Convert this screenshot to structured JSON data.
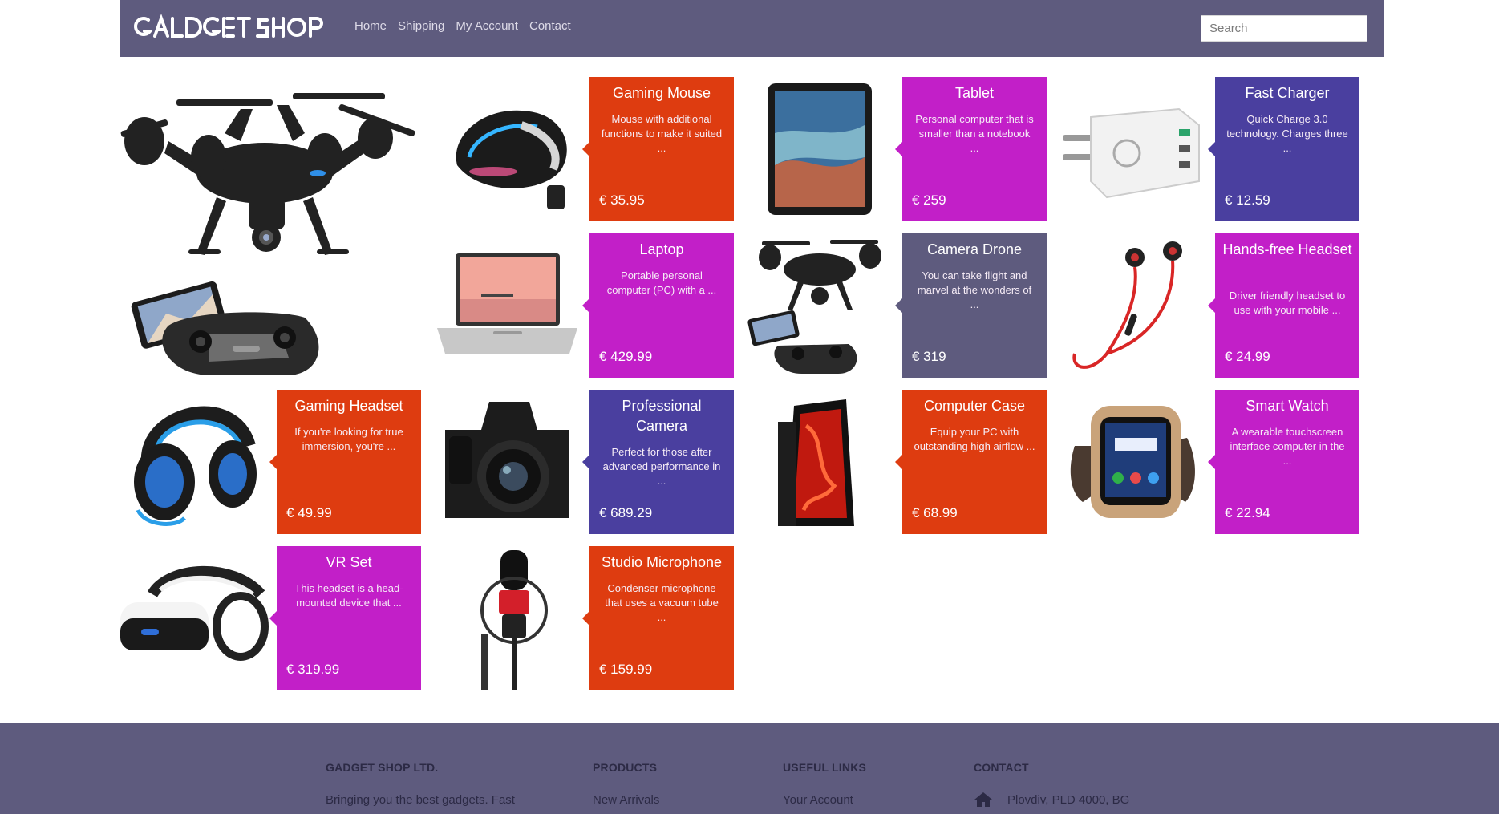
{
  "header": {
    "logo_text": "GADGET SHOP",
    "nav": [
      "Home",
      "Shipping",
      "My Account",
      "Contact"
    ],
    "search_placeholder": "Search"
  },
  "colors": {
    "nav_bg": "#5e5b7e",
    "orange": "#de3c10",
    "magenta": "#c21fc8",
    "indigo": "#4a3f9f",
    "slate": "#5e5b7e"
  },
  "products": [
    {
      "title": "Gaming Mouse",
      "desc": "Mouse with additional functions to make it suited ...",
      "price": "€ 35.95",
      "color": "orange",
      "image": "gaming-mouse-image"
    },
    {
      "title": "Tablet",
      "desc": "Personal computer that is smaller than a notebook ...",
      "price": "€ 259",
      "color": "magenta",
      "image": "tablet-image"
    },
    {
      "title": "Fast Charger",
      "desc": "Quick Charge 3.0 technology. Charges three ...",
      "price": "€ 12.59",
      "color": "indigo",
      "image": "charger-image"
    },
    {
      "title": "Laptop",
      "desc": "Portable personal computer (PC) with a ...",
      "price": "€ 429.99",
      "color": "magenta",
      "image": "laptop-image"
    },
    {
      "title": "Camera Drone",
      "desc": "You can take flight and marvel at the wonders of ...",
      "price": "€ 319",
      "color": "slate",
      "image": "camera-drone-image"
    },
    {
      "title": "Hands-free Headset",
      "desc": "Driver friendly headset to use with your mobile ...",
      "price": "€ 24.99",
      "color": "magenta",
      "image": "earphones-image"
    },
    {
      "title": "Gaming Headset",
      "desc": "If you're looking for true immersion, you're ...",
      "price": "€ 49.99",
      "color": "orange",
      "image": "gaming-headset-image"
    },
    {
      "title": "Professional Camera",
      "desc": "Perfect for those after advanced performance in ...",
      "price": "€ 689.29",
      "color": "indigo",
      "image": "camera-image"
    },
    {
      "title": "Computer Case",
      "desc": "Equip your PC with outstanding high airflow ...",
      "price": "€ 68.99",
      "color": "orange",
      "image": "pc-case-image"
    },
    {
      "title": "Smart Watch",
      "desc": "A wearable touchscreen interface computer in the ...",
      "price": "€ 22.94",
      "color": "magenta",
      "image": "smart-watch-image"
    },
    {
      "title": "VR Set",
      "desc": "This headset is a head-mounted device that ...",
      "price": "€ 319.99",
      "color": "magenta",
      "image": "vr-headset-image"
    },
    {
      "title": "Studio Microphone",
      "desc": "Condenser microphone that uses a vacuum tube ...",
      "price": "€ 159.99",
      "color": "orange",
      "image": "microphone-image"
    }
  ],
  "footer": {
    "company": {
      "heading": "GADGET SHOP LTD.",
      "text": "Bringing you the best gadgets. Fast"
    },
    "products": {
      "heading": "PRODUCTS",
      "link": "New Arrivals"
    },
    "useful_links": {
      "heading": "USEFUL LINKS",
      "link": "Your Account"
    },
    "contact": {
      "heading": "CONTACT",
      "address": "Plovdiv, PLD 4000, BG",
      "icon": "home-icon"
    }
  }
}
